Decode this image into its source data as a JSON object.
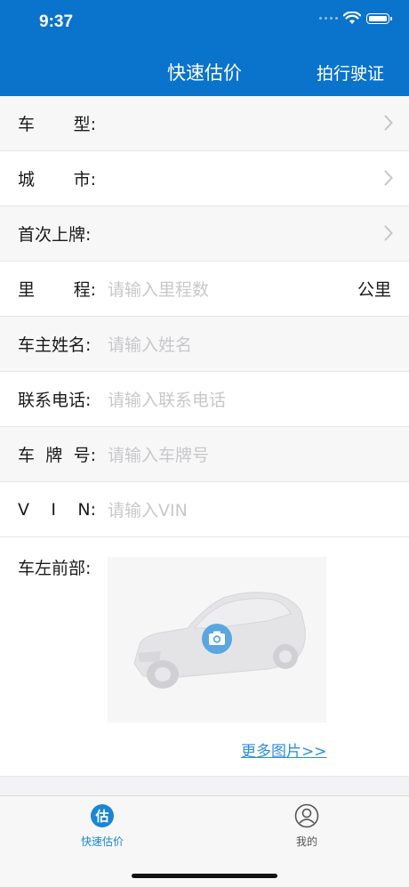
{
  "status": {
    "time": "9:37"
  },
  "nav": {
    "title": "快速估价",
    "right_action": "拍行驶证"
  },
  "form": {
    "car_model": {
      "label_chars": [
        "车",
        "型:"
      ],
      "value": ""
    },
    "city": {
      "label_chars": [
        "城",
        "市:"
      ],
      "value": ""
    },
    "first_registration": {
      "label_chars": [
        "首次上牌:"
      ],
      "value": ""
    },
    "mileage": {
      "label_chars": [
        "里",
        "程:"
      ],
      "placeholder": "请输入里程数",
      "unit": "公里"
    },
    "owner_name": {
      "label_chars": [
        "车主姓名:"
      ],
      "placeholder": "请输入姓名"
    },
    "contact_phone": {
      "label_chars": [
        "联系电话:"
      ],
      "placeholder": "请输入联系电话"
    },
    "plate_number": {
      "label_chars": [
        "车",
        "牌",
        "号:"
      ],
      "placeholder": "请输入车牌号"
    },
    "vin": {
      "label_chars": [
        "V",
        "I",
        "N:"
      ],
      "placeholder": "请输入VIN"
    },
    "front_left": {
      "label": "车左前部:",
      "more_link": "更多图片>>"
    }
  },
  "tabbar": {
    "tabs": [
      {
        "label": "快速估价",
        "icon_char": "估",
        "active": true
      },
      {
        "label": "我的",
        "active": false
      }
    ]
  },
  "colors": {
    "brand_blue": "#0a73cc",
    "placeholder_gray": "#c8c8cc",
    "link_blue": "#2d8fd8"
  }
}
